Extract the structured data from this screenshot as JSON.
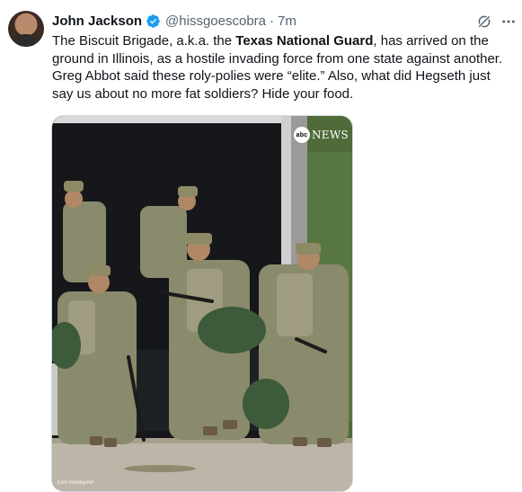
{
  "author": {
    "name": "John Jackson",
    "handle": "@hissgoescobra",
    "separator": "·",
    "time": "7m"
  },
  "body": {
    "part1": "The Biscuit Brigade, a.k.a. the ",
    "bold": "Texas National Guard",
    "part2": ", has arrived on the ground in Illinois, as a hostile invading force from one state against another. Greg Abbot said these roly-polies were “elite.” Also, what did Hegseth just say us about no more fat soldiers?  Hide your food."
  },
  "media": {
    "watermark_logo": "abc",
    "watermark_text": "NEWS",
    "credit": "Erin Hooley/AP"
  },
  "icons": {
    "verified": "verified-badge-icon",
    "grok": "grok-icon",
    "more": "more-icon"
  },
  "colors": {
    "verified": "#1d9bf0",
    "secondary_text": "#536471"
  }
}
